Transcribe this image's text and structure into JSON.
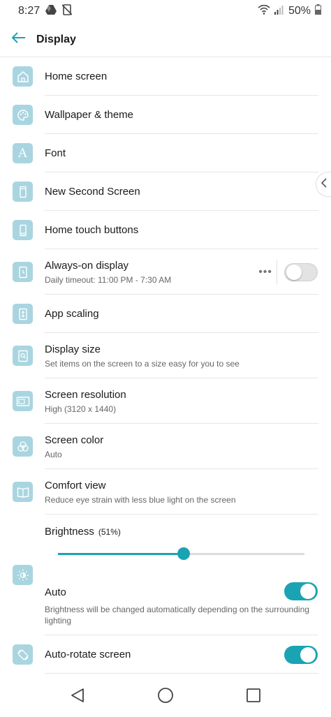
{
  "status_bar": {
    "time": "8:27",
    "battery": "50%"
  },
  "app_bar": {
    "title": "Display"
  },
  "items": [
    {
      "title": "Home screen"
    },
    {
      "title": "Wallpaper & theme"
    },
    {
      "title": "Font",
      "icon_letter": "A"
    },
    {
      "title": "New Second Screen"
    },
    {
      "title": "Home touch buttons"
    },
    {
      "title": "Always-on display",
      "subtitle": "Daily timeout: 11:00 PM - 7:30 AM",
      "more": "•••",
      "toggle": false
    },
    {
      "title": "App scaling"
    },
    {
      "title": "Display size",
      "subtitle": "Set items on the screen to a size easy for you to see"
    },
    {
      "title": "Screen resolution",
      "subtitle": "High (3120 x 1440)"
    },
    {
      "title": "Screen color",
      "subtitle": "Auto"
    },
    {
      "title": "Comfort view",
      "subtitle": "Reduce eye strain with less blue light on the screen"
    }
  ],
  "brightness": {
    "label": "Brightness",
    "percent_label": "(51%)",
    "level": 0.51,
    "auto_title": "Auto",
    "auto_subtitle": "Brightness will be changed automatically depending on the surrounding lighting",
    "auto_toggle": true
  },
  "auto_rotate": {
    "title": "Auto-rotate screen",
    "toggle": true
  },
  "colors": {
    "accent": "#1aa3b3",
    "icon_bg": "#a9d5e0"
  }
}
